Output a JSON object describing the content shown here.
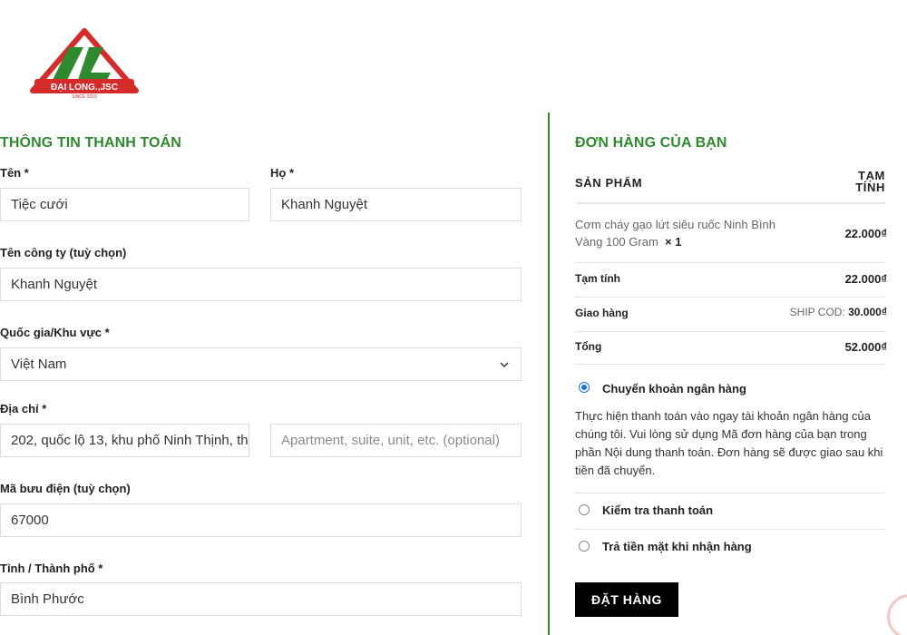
{
  "brand": {
    "logo_text": "ĐẠI LONG.,JSC",
    "logo_since": "SINCE 2010",
    "colors": {
      "green": "#2f8a2f",
      "red": "#d62b2b"
    }
  },
  "billing": {
    "title": "THÔNG TIN THANH TOÁN",
    "first_name": {
      "label": "Tên *",
      "value": "Tiệc cưới"
    },
    "last_name": {
      "label": "Họ *",
      "value": "Khanh Nguyệt"
    },
    "company": {
      "label": "Tên công ty (tuỳ chọn)",
      "value": "Khanh Nguyệt"
    },
    "country": {
      "label": "Quốc gia/Khu vực *",
      "value": "Việt Nam"
    },
    "address": {
      "label": "Địa chỉ *",
      "value": "202, quốc lộ 13, khu phố Ninh Thịnh, th",
      "placeholder2": "Apartment, suite, unit, etc. (optional)"
    },
    "postcode": {
      "label": "Mã bưu điện (tuỳ chọn)",
      "value": "67000"
    },
    "city": {
      "label": "Tỉnh / Thành phố *",
      "value": "Bình Phước"
    }
  },
  "order": {
    "title": "ĐƠN HÀNG CỦA BẠN",
    "col_product": "SẢN PHẨM",
    "col_subtotal_1": "TẠM",
    "col_subtotal_2": "TÍNH",
    "product_name": "Cơm cháy gạo lứt siêu ruốc Ninh Bình Vàng 100 Gram",
    "product_qty": "× 1",
    "product_price": "22.000₫",
    "subtotal_label": "Tạm tính",
    "subtotal_value": "22.000₫",
    "shipping_label": "Giao hàng",
    "shipping_method": "SHIP COD:",
    "shipping_value": "30.000₫",
    "total_label": "Tổng",
    "total_value": "52.000₫"
  },
  "payment": {
    "bank_label": "Chuyển khoản ngân hàng",
    "bank_desc": "Thực hiện thanh toán vào ngay tài khoản ngân hàng của chúng tôi. Vui lòng sử dụng Mã đơn hàng của bạn trong phần Nội dung thanh toán. Đơn hàng sẽ được giao sau khi tiền đã chuyển.",
    "check_label": "Kiểm tra thanh toán",
    "cod_label": "Trả tiền mặt khi nhận hàng",
    "selected": "bank"
  },
  "place_order": {
    "label": "ĐẶT HÀNG"
  }
}
